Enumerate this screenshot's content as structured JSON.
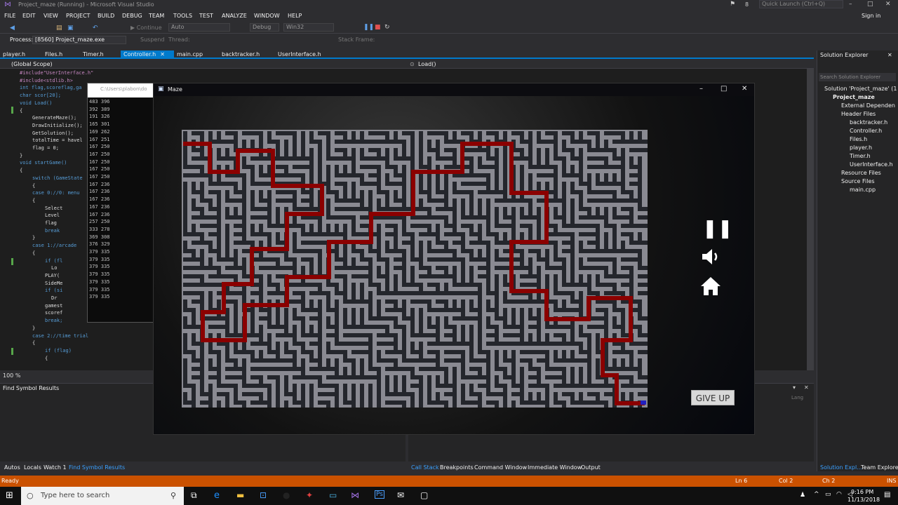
{
  "window": {
    "title": "Project_maze (Running) - Microsoft Visual Studio",
    "quick_launch": "Quick Launch (Ctrl+Q)",
    "notif_count": "8",
    "signin": "Sign in"
  },
  "menu": [
    "FILE",
    "EDIT",
    "VIEW",
    "PROJECT",
    "BUILD",
    "DEBUG",
    "TEAM",
    "TOOLS",
    "TEST",
    "ANALYZE",
    "WINDOW",
    "HELP"
  ],
  "toolbar": {
    "continue": "Continue",
    "config": "Auto",
    "debug": "Debug",
    "platform": "Win32"
  },
  "process": {
    "label": "Process:",
    "value": "[8560] Project_maze.exe",
    "suspend": "Suspend",
    "thread": "Thread:",
    "stack": "Stack Frame:"
  },
  "tabs": [
    "player.h",
    "Files.h",
    "Timer.h",
    "Controller.h",
    "main.cpp",
    "backtracker.h",
    "UserInterface.h"
  ],
  "nav": {
    "scope": "(Global Scope)",
    "member": "Load()"
  },
  "code": [
    "#include\"UserInterface.h\"",
    "#include<stdlib.h>",
    "int flag,scoreflag,ga",
    "char scor[20];",
    "void Load()",
    "{",
    "GenerateMaze();",
    "DrawInitialize();",
    "GetSolution();",
    "totalTime = havel",
    "flag = 0;",
    "}",
    "void startGame()",
    "{",
    "switch (GameState",
    "{",
    "case 0://0: menu",
    "{",
    "Select",
    "Level",
    "flag",
    "break",
    "}",
    "case 1://arcade",
    "{",
    "if (fl",
    "Lo",
    "PLAY(",
    "SideMe",
    "if (si",
    "Dr",
    "gamest",
    "scoref",
    "break;",
    "}",
    "case 2://time trial",
    "{",
    "if (flag)",
    "{"
  ],
  "console": {
    "title": "C:\\Users\\plabon\\do",
    "rows": [
      "483 396",
      "392 389",
      "191 326",
      "165 301",
      "169 262",
      "167 251",
      "167 250",
      "167 250",
      "167 250",
      "167 250",
      "167 250",
      "167 236",
      "167 236",
      "167 236",
      "167 236",
      "167 236",
      "257 250",
      "333 278",
      "369 308",
      "376 329",
      "379 335",
      "379 335",
      "379 335",
      "379 335",
      "379 335",
      "379 335",
      "379 335"
    ]
  },
  "zoom": "100 %",
  "maze_window": {
    "title": "Maze",
    "give_up": "GIVE UP"
  },
  "panels": {
    "find": "Find Symbol Results",
    "right_hint": "Lang"
  },
  "bottom_tabs_left": [
    "Autos",
    "Locals",
    "Watch 1",
    "Find Symbol Results"
  ],
  "bottom_tabs_right": [
    "Call Stack",
    "Breakpoints",
    "Command Window",
    "Immediate Window",
    "Output"
  ],
  "solution": {
    "title": "Solution Explorer",
    "search": "Search Solution Explorer",
    "items": [
      "Solution 'Project_maze' (1",
      "Project_maze",
      "External Dependen",
      "Header Files",
      "backtracker.h",
      "Controller.h",
      "Files.h",
      "player.h",
      "Timer.h",
      "UserInterface.h",
      "Resource Files",
      "Source Files",
      "main.cpp"
    ],
    "bottom_tabs": [
      "Solution Expl...",
      "Team Explorer"
    ]
  },
  "status": {
    "state": "Ready",
    "ln": "Ln 6",
    "col": "Col 2",
    "ch": "Ch 2",
    "ins": "INS"
  },
  "taskbar": {
    "search": "Type here to search",
    "time": "9:16 PM",
    "date": "11/13/2018"
  },
  "colors": {
    "accent": "#007acc",
    "status": "#ca5100",
    "path": "#8b0000",
    "wall": "#8a8a92"
  }
}
